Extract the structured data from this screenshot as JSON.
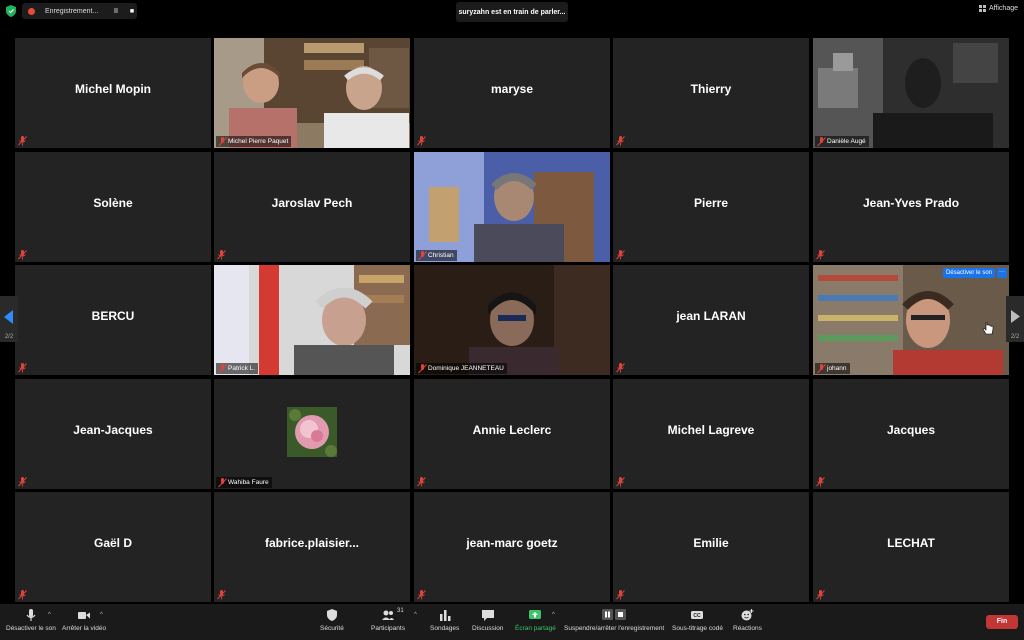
{
  "topbar": {
    "recording_label": "Enregistrement...",
    "pause_symbol": "II",
    "stop_symbol": "■",
    "speaking": "suryzahn est en train de parler...",
    "view_label": "Affichage"
  },
  "tiles": [
    {
      "name": "Michel Mopin"
    },
    {
      "name": "Michel Pierre Paquet"
    },
    {
      "name": "maryse"
    },
    {
      "name": "Thierry"
    },
    {
      "name": "Danièle Augé"
    },
    {
      "name": "Solène"
    },
    {
      "name": "Jaroslav Pech"
    },
    {
      "name": "Christian"
    },
    {
      "name": "Pierre"
    },
    {
      "name": "Jean-Yves Prado"
    },
    {
      "name": "BERCU"
    },
    {
      "name": "Patrick L."
    },
    {
      "name": "Dominique JEANNETEAU"
    },
    {
      "name": "jean  LARAN"
    },
    {
      "name": "johann"
    },
    {
      "name": "Jean-Jacques"
    },
    {
      "name": "Wahiba Faure"
    },
    {
      "name": "Annie Leclerc"
    },
    {
      "name": "Michel Lagreve"
    },
    {
      "name": "Jacques"
    },
    {
      "name": "Gaël D"
    },
    {
      "name": "fabrice.plaisier..."
    },
    {
      "name": "jean-marc goetz"
    },
    {
      "name": "Emilie"
    },
    {
      "name": "LECHAT"
    }
  ],
  "tile_overlay": {
    "unmute_label": "Désactiver le son",
    "more_label": "···"
  },
  "pager": {
    "left": "2/2",
    "right": "2/2"
  },
  "toolbar": {
    "mute": "Désactiver le son",
    "video": "Arrêter la vidéo",
    "security": "Sécurité",
    "participants": "Participants",
    "participants_count": "31",
    "polls": "Sondages",
    "chat": "Discussion",
    "share": "Écran partagé",
    "record": "Suspendre/arrêter l'enregistrement",
    "captions": "Sous-titrage codé",
    "reactions": "Réactions",
    "end": "Fin",
    "caret": "^"
  },
  "colors": {
    "tile_bg": "#232323",
    "mute_red": "#e0433a",
    "share_green": "#3cc46a",
    "end_red": "#c23636",
    "accent_blue": "#1a73e8"
  }
}
